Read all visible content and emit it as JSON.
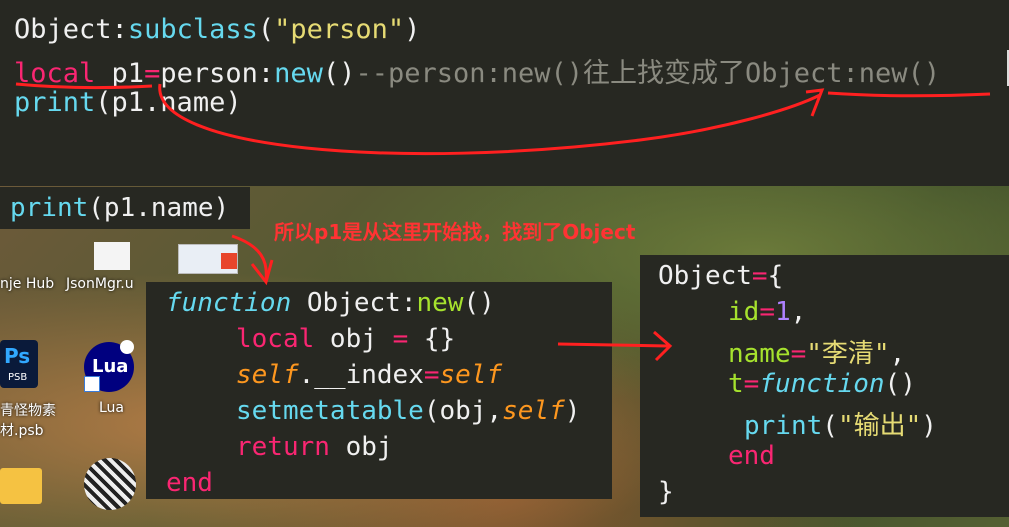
{
  "top_code": {
    "line1": {
      "obj": "Object",
      "colon": ":",
      "fn": "subclass",
      "open": "(",
      "str": "\"person\"",
      "close": ")"
    },
    "line2": {
      "local": "local",
      "sp": " ",
      "var": "p1",
      "eq": "=",
      "person": "person",
      "colon": ":",
      "new": "new",
      "parens": "()",
      "comment": "--person:new()往上找变成了Object:new()"
    },
    "line3": {
      "print": "print",
      "rest": "(p1.name)"
    }
  },
  "desktop": {
    "print_code": {
      "print": "print",
      "rest": "(p1.name)"
    },
    "annotation": "所以p1是从这里开始找，找到了Object",
    "icons": [
      {
        "label": "nje Hub"
      },
      {
        "label": "JsonMgr.u"
      },
      {
        "label": "青怪物素"
      },
      {
        "label": "材.psb"
      },
      {
        "label": "Lua"
      }
    ],
    "ps_badge": {
      "top": "Ps",
      "bottom": "PSB"
    },
    "lua_badge": "Lua",
    "new_fn": {
      "l1_kw": "function",
      "l1_name": " Object",
      "l1_colon": ":",
      "l1_new": "new",
      "l1_paren": "()",
      "l2_local": "local",
      "l2_rest": " obj ",
      "l2_eq": "=",
      "l2_brace": " {}",
      "l3_self": "self",
      "l3_index": ".__index",
      "l3_eq": "=",
      "l3_self2": "self",
      "l4_fn": "setmetatable",
      "l4_open": "(obj,",
      "l4_self": "self",
      "l4_close": ")",
      "l5_ret": "return",
      "l5_obj": " obj",
      "l6_end": "end"
    },
    "object_def": {
      "l1_name": "Object",
      "l1_eq": "=",
      "l1_brace": "{",
      "l2_key": "id",
      "l2_eq": "=",
      "l2_val": "1",
      "l2_comma": ",",
      "l3_key": "name",
      "l3_eq": "=",
      "l3_val": "\"李清\"",
      "l3_comma": ",",
      "l4_key": "t",
      "l4_eq": "=",
      "l4_fn": "function",
      "l4_paren": "()",
      "l5_print": "print",
      "l5_open": "(",
      "l5_str": "\"输出\"",
      "l5_close": ")",
      "l6_end": "end",
      "l7_close": "}"
    }
  },
  "colors": {
    "editor_bg": "#272822",
    "annotation": "#ff3333",
    "keyword_cyan": "#66d9ef",
    "keyword_pink": "#f92672",
    "string": "#e6db74",
    "comment": "#8a8a80"
  }
}
